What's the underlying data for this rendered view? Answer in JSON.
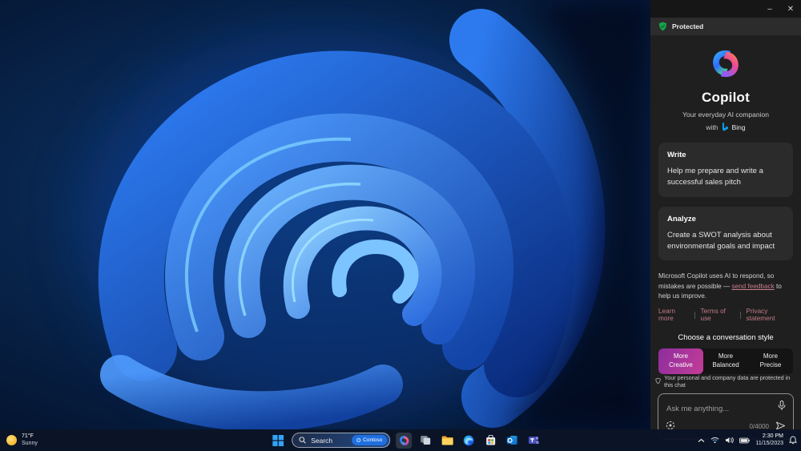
{
  "copilot": {
    "titlebar": {
      "minimize": "–",
      "close": "✕"
    },
    "protected": {
      "label": "Protected"
    },
    "hero": {
      "title": "Copilot",
      "tagline": "Your everyday AI companion",
      "with_prefix": "with",
      "brand": "Bing"
    },
    "cards": [
      {
        "title": "Write",
        "body": "Help me prepare and write a successful sales pitch"
      },
      {
        "title": "Analyze",
        "body": "Create a SWOT analysis about environmental goals and impact"
      }
    ],
    "disclaimer": {
      "before": "Microsoft Copilot uses AI to respond, so mistakes are possible — ",
      "link": "send feedback",
      "after": " to help us improve."
    },
    "footer_links": [
      "Learn more",
      "Terms of use",
      "Privacy statement"
    ],
    "style_picker": {
      "heading": "Choose a conversation style",
      "options": [
        {
          "line1": "More",
          "line2": "Creative",
          "selected": true
        },
        {
          "line1": "More",
          "line2": "Balanced",
          "selected": false
        },
        {
          "line1": "More",
          "line2": "Precise",
          "selected": false
        }
      ]
    },
    "privacy_note": "Your personal and company data are protected in this chat",
    "composer": {
      "placeholder": "Ask me anything...",
      "counter": "0/4000"
    }
  },
  "taskbar": {
    "weather": {
      "temperature": "71°F",
      "condition": "Sunny"
    },
    "search": {
      "label": "Search",
      "badge": "Contoso"
    },
    "apps": [
      "copilot",
      "task-view",
      "file-explorer",
      "edge",
      "store",
      "outlook",
      "teams"
    ],
    "tray_icons": [
      "chevron-up",
      "wifi",
      "volume",
      "battery",
      "bell"
    ],
    "clock": {
      "time": "2:30 PM",
      "date": "11/15/2023"
    }
  },
  "colors": {
    "selected_style_gradient_start": "#8d2d9d",
    "selected_style_gradient_end": "#c23d97",
    "link_color": "#c77e8a",
    "protected_green": "#16a34a",
    "taskbar_bg": "#0a1528",
    "panel_bg": "#1f1f1f",
    "card_bg": "#2b2b2b"
  }
}
